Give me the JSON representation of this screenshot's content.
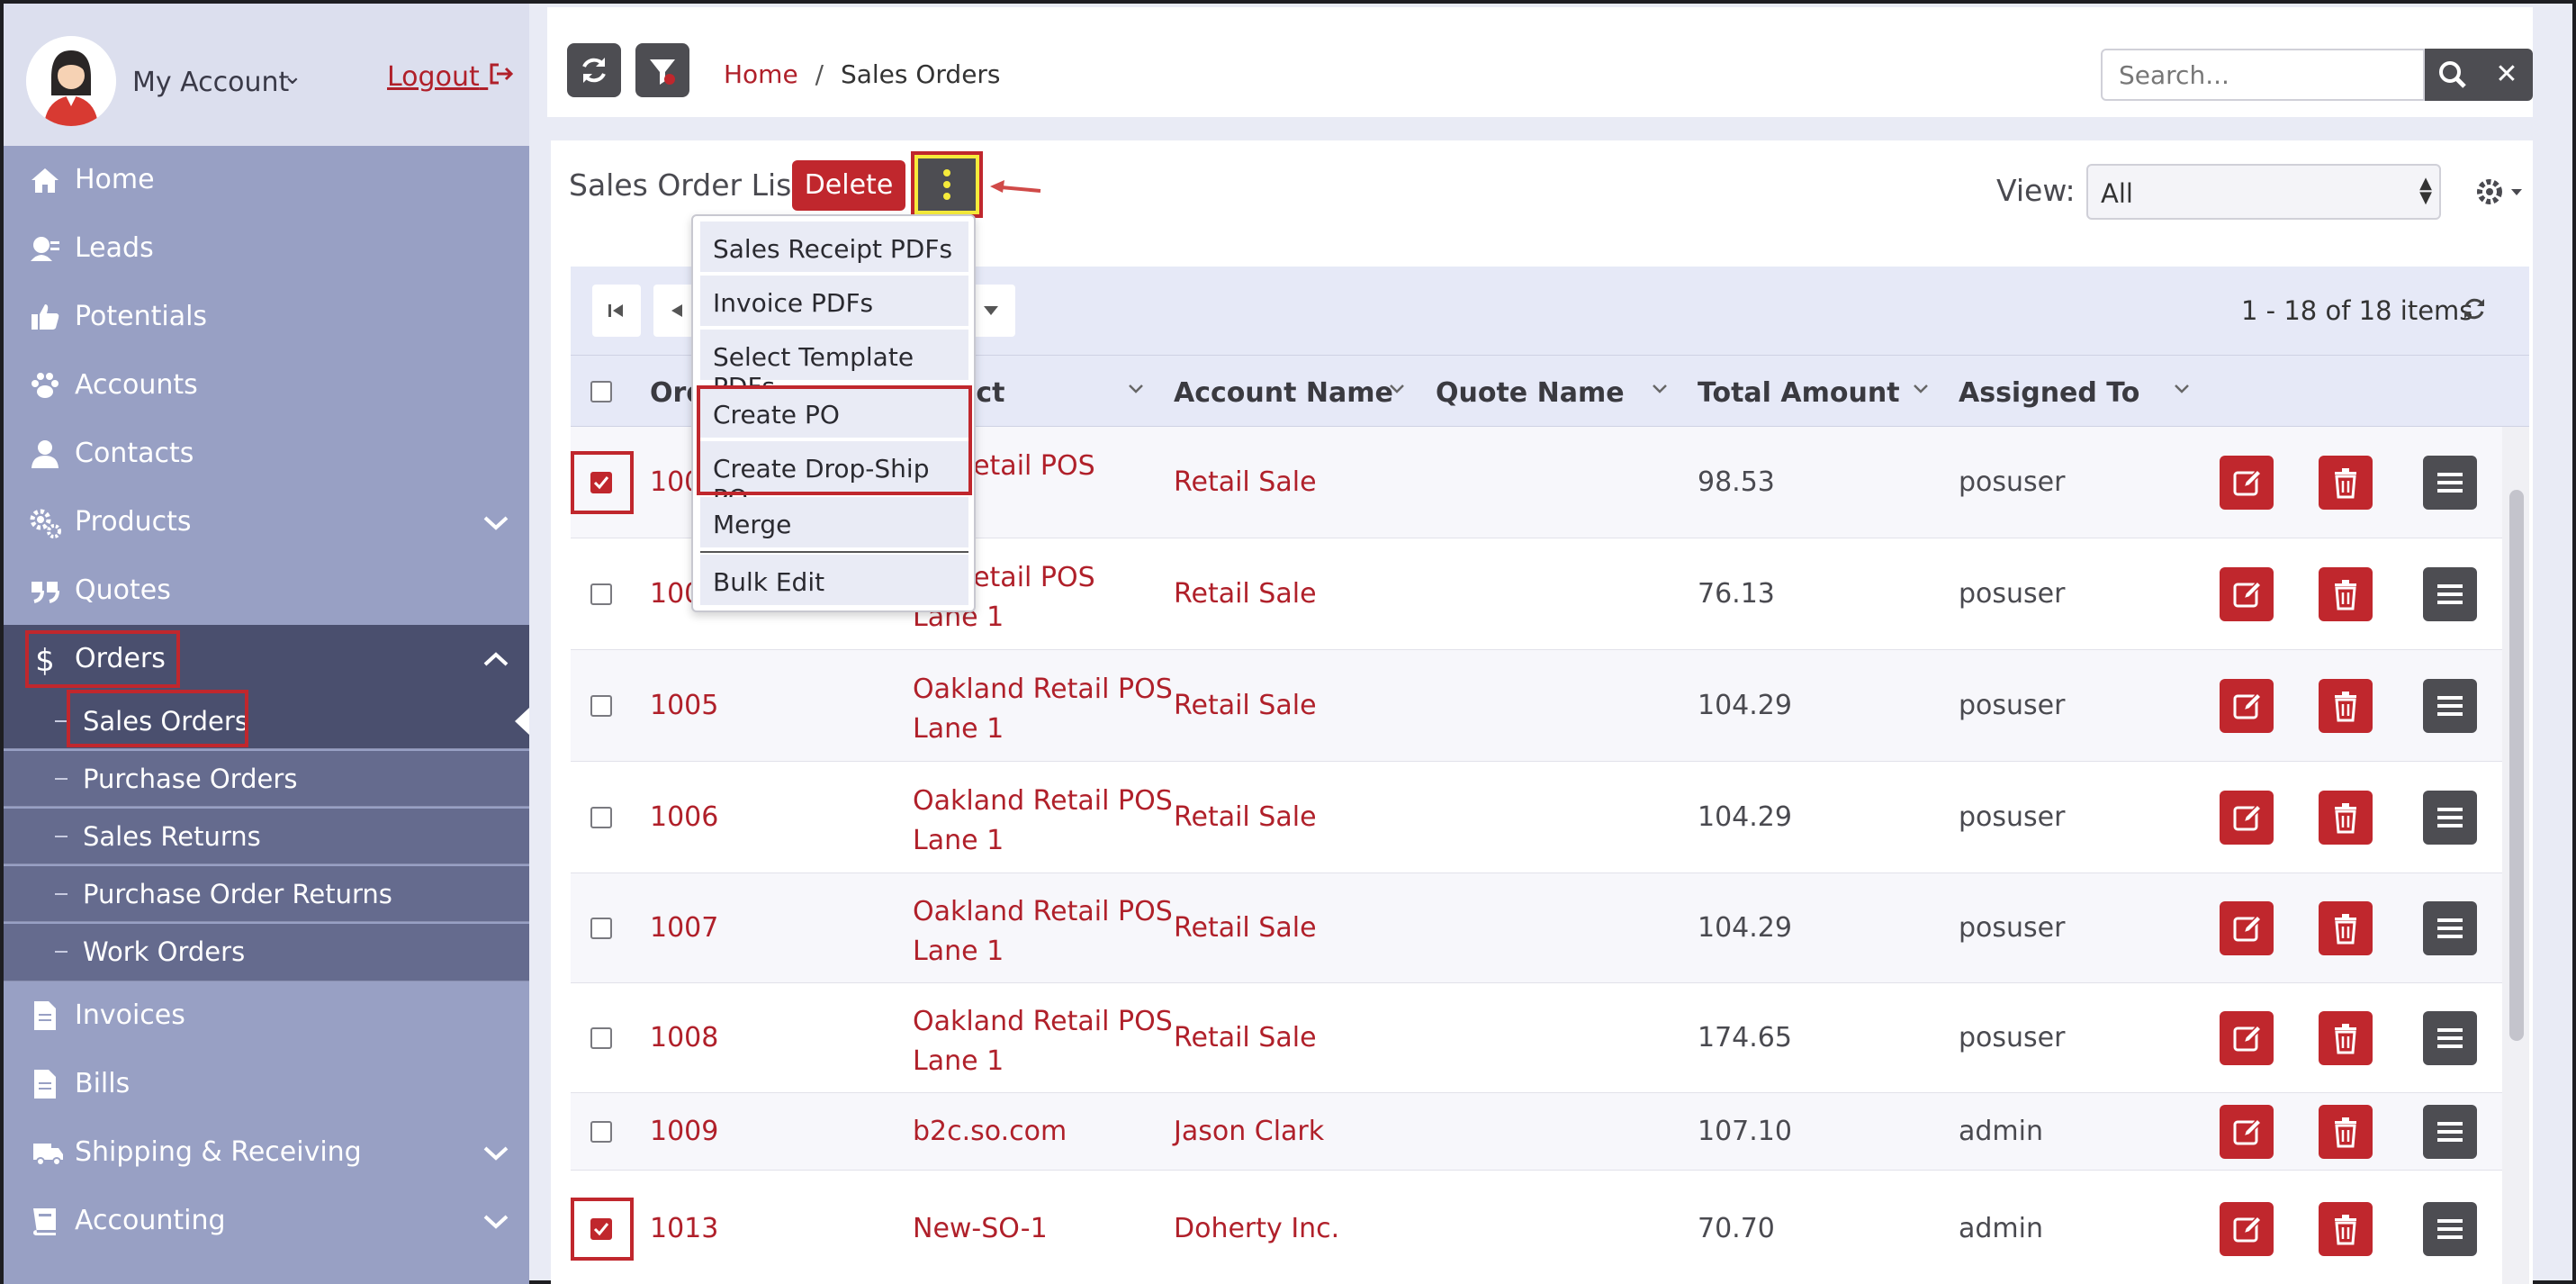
{
  "account": {
    "label": "My Account",
    "logout": "Logout"
  },
  "sidebar": {
    "items": [
      {
        "label": "Home",
        "icon": "home-icon"
      },
      {
        "label": "Leads",
        "icon": "leads-icon"
      },
      {
        "label": "Potentials",
        "icon": "thumbs-up-icon"
      },
      {
        "label": "Accounts",
        "icon": "paw-icon"
      },
      {
        "label": "Contacts",
        "icon": "user-icon"
      },
      {
        "label": "Products",
        "icon": "gears-icon"
      },
      {
        "label": "Quotes",
        "icon": "quote-icon"
      },
      {
        "label": "Orders",
        "icon": "dollar-icon"
      },
      {
        "label": "Invoices",
        "icon": "file-icon"
      },
      {
        "label": "Bills",
        "icon": "file-icon"
      },
      {
        "label": "Shipping & Receiving",
        "icon": "truck-icon"
      },
      {
        "label": "Accounting",
        "icon": "book-icon"
      }
    ],
    "orders_sub": [
      "Sales Orders",
      "Purchase Orders",
      "Sales Returns",
      "Purchase Order Returns",
      "Work Orders"
    ]
  },
  "breadcrumb": {
    "home": "Home",
    "sep": "/",
    "current": "Sales Orders"
  },
  "search": {
    "placeholder": "Search..."
  },
  "list": {
    "title": "Sales Order List",
    "delete_label": "Delete",
    "view_label": "View:",
    "view_value": "All",
    "item_count": "1 - 18 of 18 items"
  },
  "dropdown": [
    "Sales Receipt PDFs",
    "Invoice PDFs",
    "Select Template PDFs",
    "Create PO",
    "Create Drop-Ship PO",
    "Merge",
    "Bulk Edit"
  ],
  "columns": [
    "Ord",
    "ect",
    "Account Name",
    "Quote Name",
    "Total Amount",
    "Assigned To"
  ],
  "rows": [
    {
      "order": "100",
      "subject": [
        "nd Retail POS",
        "1"
      ],
      "account": "Retail Sale",
      "total": "98.53",
      "assigned": "posuser",
      "checked": true
    },
    {
      "order": "100",
      "subject": [
        "nd Retail POS",
        "Lane 1"
      ],
      "account": "Retail Sale",
      "total": "76.13",
      "assigned": "posuser",
      "checked": false
    },
    {
      "order": "1005",
      "subject": [
        "Oakland Retail POS",
        "Lane 1"
      ],
      "account": "Retail Sale",
      "total": "104.29",
      "assigned": "posuser",
      "checked": false
    },
    {
      "order": "1006",
      "subject": [
        "Oakland Retail POS",
        "Lane 1"
      ],
      "account": "Retail Sale",
      "total": "104.29",
      "assigned": "posuser",
      "checked": false
    },
    {
      "order": "1007",
      "subject": [
        "Oakland Retail POS",
        "Lane 1"
      ],
      "account": "Retail Sale",
      "total": "104.29",
      "assigned": "posuser",
      "checked": false
    },
    {
      "order": "1008",
      "subject": [
        "Oakland Retail POS",
        "Lane 1"
      ],
      "account": "Retail Sale",
      "total": "174.65",
      "assigned": "posuser",
      "checked": false
    },
    {
      "order": "1009",
      "subject": [
        "b2c.so.com"
      ],
      "account": "Jason Clark",
      "total": "107.10",
      "assigned": "admin",
      "checked": false
    },
    {
      "order": "1013",
      "subject": [
        "New-SO-1"
      ],
      "account": "Doherty Inc.",
      "total": "70.70",
      "assigned": "admin",
      "checked": true
    }
  ],
  "colors": {
    "accent": "#c0272d",
    "sidebar": "#98a0c4",
    "sidebar_active": "#4a4f6e",
    "highlight": "#f6eb3b"
  }
}
